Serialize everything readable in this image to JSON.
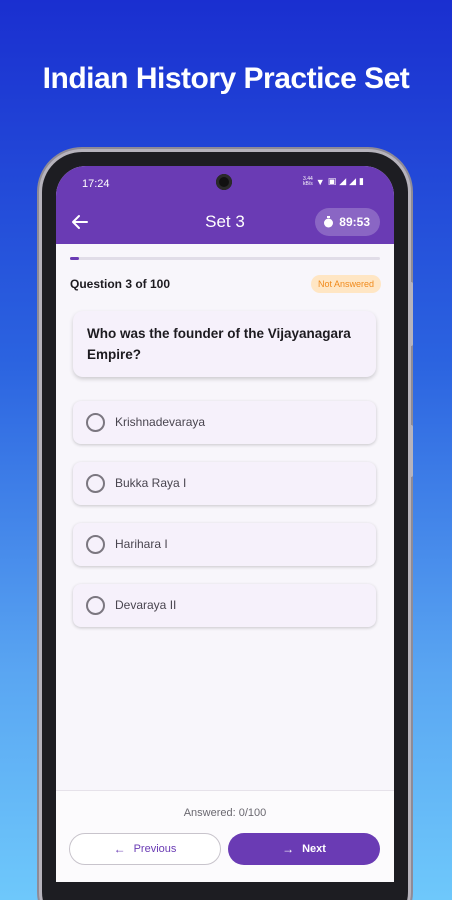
{
  "promo": {
    "title": "Indian History Practice Set"
  },
  "status_bar": {
    "time": "17:24",
    "net_speed_top": "3.44",
    "net_speed_bottom": "kB/s"
  },
  "app_bar": {
    "title": "Set 3",
    "timer": "89:53"
  },
  "quiz": {
    "question_counter": "Question 3 of 100",
    "status_badge": "Not Answered",
    "progress_fraction": 0.03,
    "question": "Who was the founder of the Vijayanagara Empire?",
    "options": [
      "Krishnadevaraya",
      "Bukka Raya I",
      "Harihara I",
      "Devaraya II"
    ]
  },
  "footer": {
    "answered": "Answered: 0/100",
    "previous_label": "Previous",
    "next_label": "Next"
  },
  "colors": {
    "primary": "#6a3bb4",
    "badge_bg": "#ffe6c4",
    "badge_text": "#f08a1c"
  }
}
